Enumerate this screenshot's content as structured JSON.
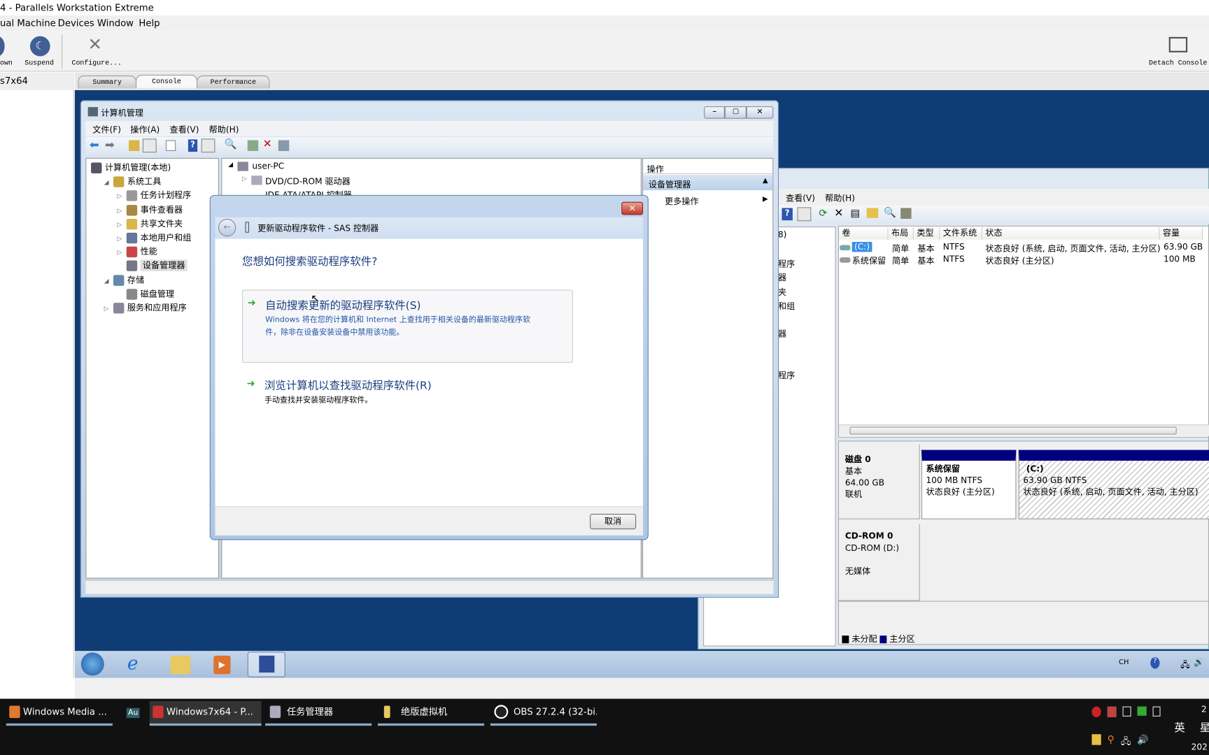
{
  "host": {
    "title": "4 - Parallels Workstation Extreme",
    "menu": [
      "ual Machine",
      "Devices",
      "Window",
      "Help"
    ],
    "toolbar": {
      "shutdown": "own",
      "suspend": "Suspend",
      "configure": "Configure...",
      "detach": "Detach Console"
    },
    "sidebar_vm": "s7x64",
    "tabs": [
      "Summary",
      "Console",
      "Performance"
    ],
    "active_tab": "Console"
  },
  "compmgmt": {
    "title": "计算机管理",
    "menu": [
      "文件(F)",
      "操作(A)",
      "查看(V)",
      "帮助(H)"
    ],
    "tree": [
      {
        "label": "计算机管理(本地)",
        "level": 0
      },
      {
        "label": "系统工具",
        "level": 1
      },
      {
        "label": "任务计划程序",
        "level": 2
      },
      {
        "label": "事件查看器",
        "level": 2
      },
      {
        "label": "共享文件夹",
        "level": 2
      },
      {
        "label": "本地用户和组",
        "level": 2
      },
      {
        "label": "性能",
        "level": 2
      },
      {
        "label": "设备管理器",
        "level": 2,
        "selected": true
      },
      {
        "label": "存储",
        "level": 1
      },
      {
        "label": "磁盘管理",
        "level": 2
      },
      {
        "label": "服务和应用程序",
        "level": 1
      }
    ],
    "devices": {
      "root": "user-PC",
      "items": [
        "DVD/CD-ROM 驱动器",
        "IDE ATA/ATAPI 控制器"
      ]
    },
    "actions": {
      "header": "操作",
      "section": "设备管理器",
      "more": "更多操作"
    }
  },
  "diskmgmt": {
    "menu": [
      "查看(V)",
      "帮助(H)"
    ],
    "nav_fragments": [
      "8)",
      "程序",
      "器",
      "夹",
      "和组",
      "器",
      "程序"
    ],
    "columns": [
      "卷",
      "布局",
      "类型",
      "文件系统",
      "状态",
      "容量"
    ],
    "volumes": [
      {
        "vol": "(C:)",
        "layout": "简单",
        "type": "基本",
        "fs": "NTFS",
        "status": "状态良好 (系统, 启动, 页面文件, 活动, 主分区)",
        "capacity": "63.90 GB"
      },
      {
        "vol": "系统保留",
        "layout": "简单",
        "type": "基本",
        "fs": "NTFS",
        "status": "状态良好 (主分区)",
        "capacity": "100 MB"
      }
    ],
    "disk0": {
      "name": "磁盘 0",
      "type": "基本",
      "size": "64.00 GB",
      "state": "联机",
      "parts": [
        {
          "name": "系统保留",
          "size": "100 MB NTFS",
          "status": "状态良好 (主分区)"
        },
        {
          "name": "(C:)",
          "size": "63.90 GB NTFS",
          "status": "状态良好 (系统, 启动, 页面文件, 活动, 主分区)"
        }
      ]
    },
    "cdrom": {
      "name": "CD-ROM 0",
      "drive": "CD-ROM (D:)",
      "media": "无媒体"
    },
    "legend": [
      "未分配",
      "主分区"
    ],
    "colors": {
      "primary": "#00007f",
      "unallocated": "#000000"
    }
  },
  "dialog": {
    "title": "更新驱动程序软件 - SAS 控制器",
    "question": "您想如何搜索驱动程序软件?",
    "opt1": {
      "title": "自动搜索更新的驱动程序软件(S)",
      "desc1": "Windows 将在您的计算机和 Internet 上查找用于相关设备的最新驱动程序软",
      "desc2": "件，除非在设备安装设备中禁用该功能。"
    },
    "opt2": {
      "title": "浏览计算机以查找驱动程序软件(R)",
      "desc": "手动查找并安装驱动程序软件。"
    },
    "cancel": "取消"
  },
  "guest_tray": {
    "lang": "CH"
  },
  "taskbar": {
    "items": [
      "Windows Media ...",
      "Au",
      "Windows7x64 - P...",
      "任务管理器",
      "绝版虚拟机",
      "OBS 27.2.4 (32-bi..."
    ],
    "ime": "英",
    "clock_top": "2",
    "clock_day": "星",
    "clock_date": "202"
  }
}
